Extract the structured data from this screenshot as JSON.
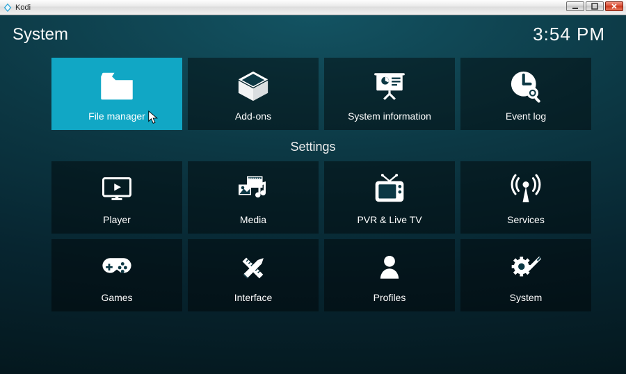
{
  "window": {
    "title": "Kodi"
  },
  "header": {
    "title": "System",
    "clock": "3:54 PM"
  },
  "top_tiles": [
    {
      "label": "File manager",
      "icon": "folder-icon",
      "selected": true
    },
    {
      "label": "Add-ons",
      "icon": "box-icon",
      "selected": false
    },
    {
      "label": "System information",
      "icon": "presentation-icon",
      "selected": false
    },
    {
      "label": "Event log",
      "icon": "clock-search-icon",
      "selected": false
    }
  ],
  "section_title": "Settings",
  "settings_tiles": [
    {
      "label": "Player",
      "icon": "monitor-play-icon"
    },
    {
      "label": "Media",
      "icon": "media-collection-icon"
    },
    {
      "label": "PVR & Live TV",
      "icon": "tv-icon"
    },
    {
      "label": "Services",
      "icon": "antenna-icon"
    },
    {
      "label": "Games",
      "icon": "gamepad-icon"
    },
    {
      "label": "Interface",
      "icon": "pencil-ruler-icon"
    },
    {
      "label": "Profiles",
      "icon": "profile-icon"
    },
    {
      "label": "System",
      "icon": "gear-screwdriver-icon"
    }
  ],
  "colors": {
    "accent": "#11a7c5",
    "tile_bg": "rgba(0,0,0,0.42)"
  }
}
